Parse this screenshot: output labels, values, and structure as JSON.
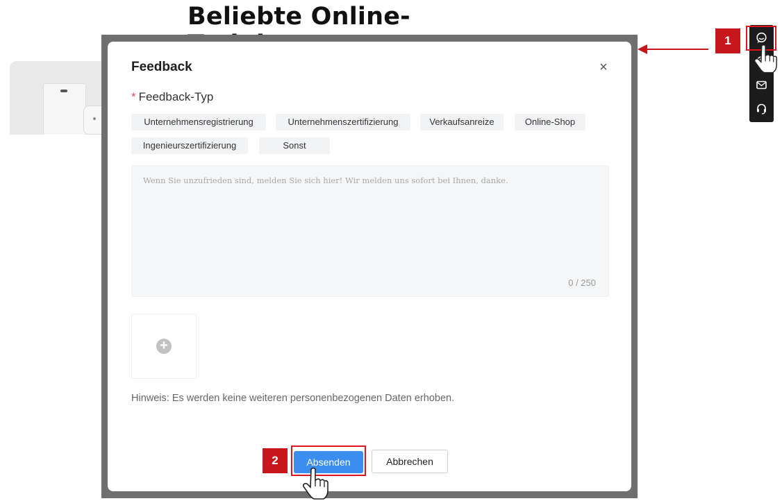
{
  "page": {
    "heading": "Beliebte Online-Training"
  },
  "dialog": {
    "title": "Feedback",
    "close_symbol": "×",
    "type_label": "Feedback-Typ",
    "required_mark": "*",
    "tags": [
      "Unternehmensregistrierung",
      "Unternehmenszertifizierung",
      "Verkaufsanreize",
      "Online-Shop",
      "Ingenieurszertifizierung",
      "Sonst"
    ],
    "textarea": {
      "placeholder": "Wenn Sie unzufrieden sind, melden Sie sich hier! Wir melden uns sofort bei Ihnen, danke.",
      "counter": "0 / 250"
    },
    "upload_symbol": "+",
    "hint": "Hinweis: Es werden keine weiteren personenbezogenen Daten erhoben.",
    "submit_label": "Absenden",
    "cancel_label": "Abbrechen"
  },
  "annotations": {
    "step1": "1",
    "step2": "2",
    "color": "#c8161d"
  },
  "sidebar": {
    "items": [
      {
        "icon": "chat-icon"
      },
      {
        "icon": "question-icon"
      },
      {
        "icon": "mail-icon"
      },
      {
        "icon": "headset-icon"
      }
    ]
  }
}
